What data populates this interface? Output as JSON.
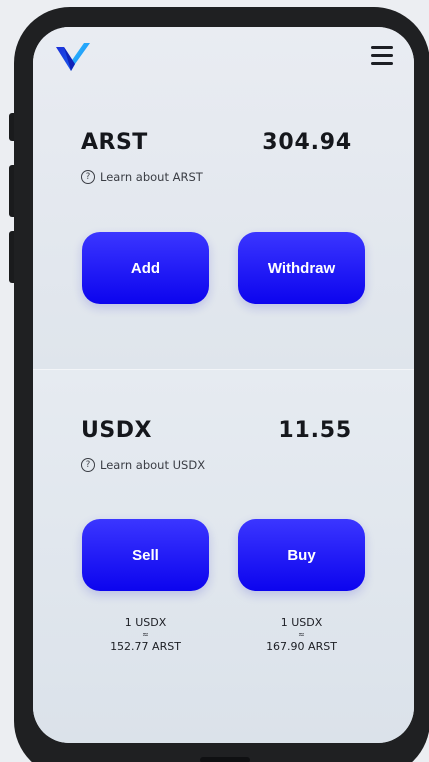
{
  "header": {
    "logo_icon": "v-logo-icon",
    "menu_icon": "hamburger-menu-icon"
  },
  "arst": {
    "name": "ARST",
    "balance": "304.94",
    "learn_text": "Learn about ARST",
    "help_icon_glyph": "?",
    "add_label": "Add",
    "withdraw_label": "Withdraw"
  },
  "usdx": {
    "name": "USDX",
    "balance": "11.55",
    "learn_text": "Learn about USDX",
    "help_icon_glyph": "?",
    "sell_label": "Sell",
    "buy_label": "Buy",
    "sell_rate": {
      "from": "1 USDX",
      "approx": "≈",
      "to": "152.77 ARST"
    },
    "buy_rate": {
      "from": "1 USDX",
      "approx": "≈",
      "to": "167.90 ARST"
    }
  },
  "colors": {
    "button_top": "#3b36ff",
    "button_bottom": "#0c04ee",
    "logo_dark": "#1a3fe0",
    "logo_light": "#2cc3ff"
  }
}
